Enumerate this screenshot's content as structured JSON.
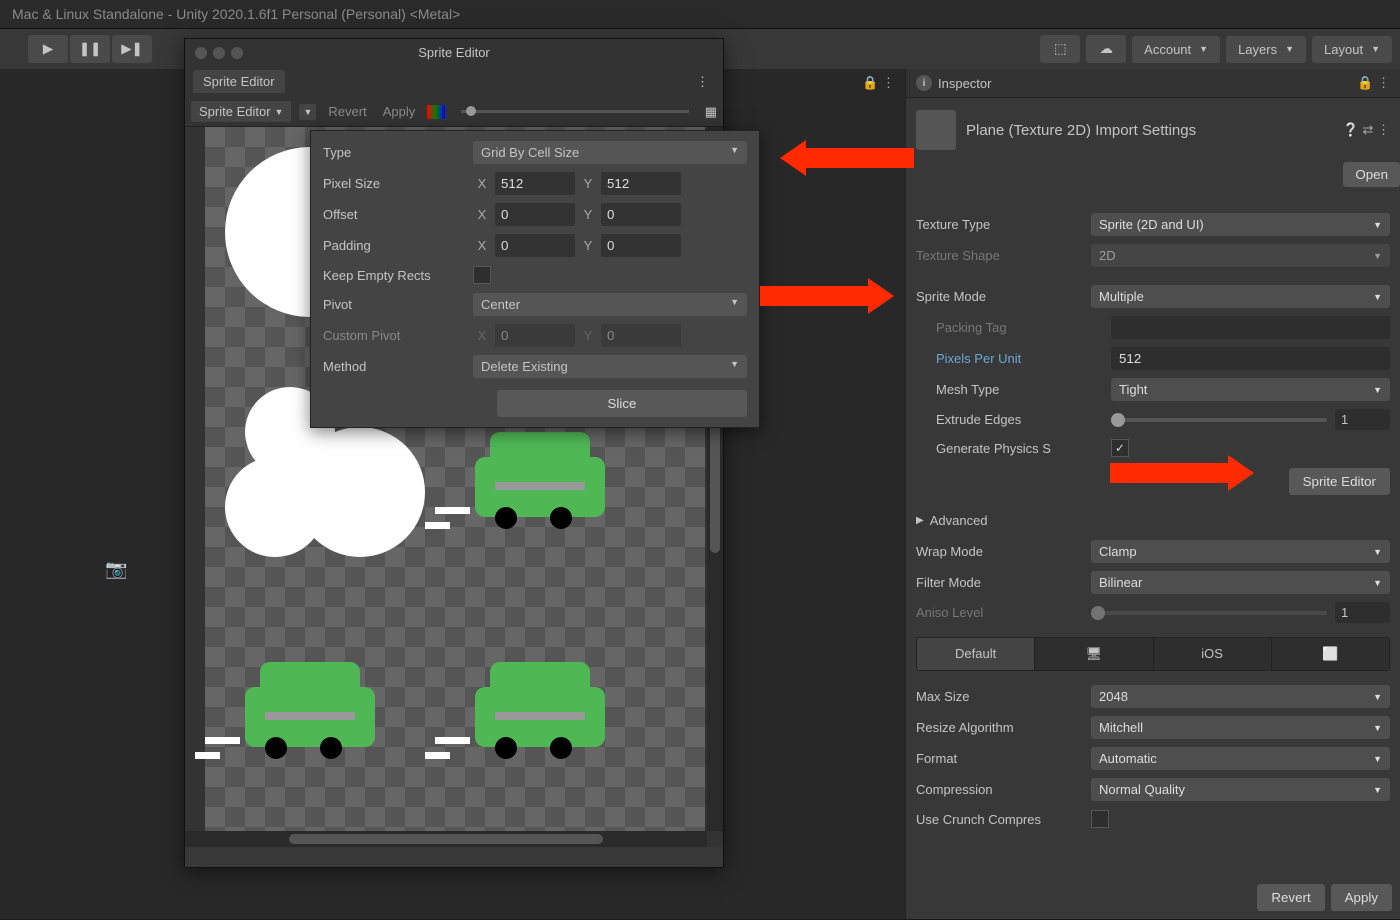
{
  "titlebar": "Mac & Linux Standalone - Unity 2020.1.6f1 Personal (Personal) <Metal>",
  "top_menus": {
    "account": "Account",
    "layers": "Layers",
    "layout": "Layout"
  },
  "inspector": {
    "tab": "Inspector",
    "title": "Plane (Texture 2D) Import Settings",
    "open_btn": "Open",
    "texture_type": {
      "label": "Texture Type",
      "value": "Sprite (2D and UI)"
    },
    "texture_shape": {
      "label": "Texture Shape",
      "value": "2D"
    },
    "sprite_mode": {
      "label": "Sprite Mode",
      "value": "Multiple"
    },
    "packing_tag": {
      "label": "Packing Tag",
      "value": ""
    },
    "pixels_per_unit": {
      "label": "Pixels Per Unit",
      "value": "512"
    },
    "mesh_type": {
      "label": "Mesh Type",
      "value": "Tight"
    },
    "extrude_edges": {
      "label": "Extrude Edges",
      "value": "1"
    },
    "generate_physics": {
      "label": "Generate Physics S",
      "checked": true
    },
    "sprite_editor_btn": "Sprite Editor",
    "advanced": "Advanced",
    "wrap_mode": {
      "label": "Wrap Mode",
      "value": "Clamp"
    },
    "filter_mode": {
      "label": "Filter Mode",
      "value": "Bilinear"
    },
    "aniso_level": {
      "label": "Aniso Level",
      "value": "1"
    },
    "platform_tabs": {
      "default": "Default",
      "ios": "iOS"
    },
    "max_size": {
      "label": "Max Size",
      "value": "2048"
    },
    "resize_algo": {
      "label": "Resize Algorithm",
      "value": "Mitchell"
    },
    "format": {
      "label": "Format",
      "value": "Automatic"
    },
    "compression": {
      "label": "Compression",
      "value": "Normal Quality"
    },
    "crunch": {
      "label": "Use Crunch Compres",
      "checked": false
    },
    "revert": "Revert",
    "apply": "Apply"
  },
  "sprite_editor": {
    "win_title": "Sprite Editor",
    "tab": "Sprite Editor",
    "toolbar_dd": "Sprite Editor",
    "revert": "Revert",
    "apply": "Apply"
  },
  "slice": {
    "type": {
      "label": "Type",
      "value": "Grid By Cell Size"
    },
    "pixel_size": {
      "label": "Pixel Size",
      "x": "512",
      "y": "512"
    },
    "offset": {
      "label": "Offset",
      "x": "0",
      "y": "0"
    },
    "padding": {
      "label": "Padding",
      "x": "0",
      "y": "0"
    },
    "keep_empty": {
      "label": "Keep Empty Rects",
      "checked": false
    },
    "pivot": {
      "label": "Pivot",
      "value": "Center"
    },
    "custom_pivot": {
      "label": "Custom Pivot",
      "x": "0",
      "y": "0"
    },
    "method": {
      "label": "Method",
      "value": "Delete Existing"
    },
    "slice_btn": "Slice"
  }
}
